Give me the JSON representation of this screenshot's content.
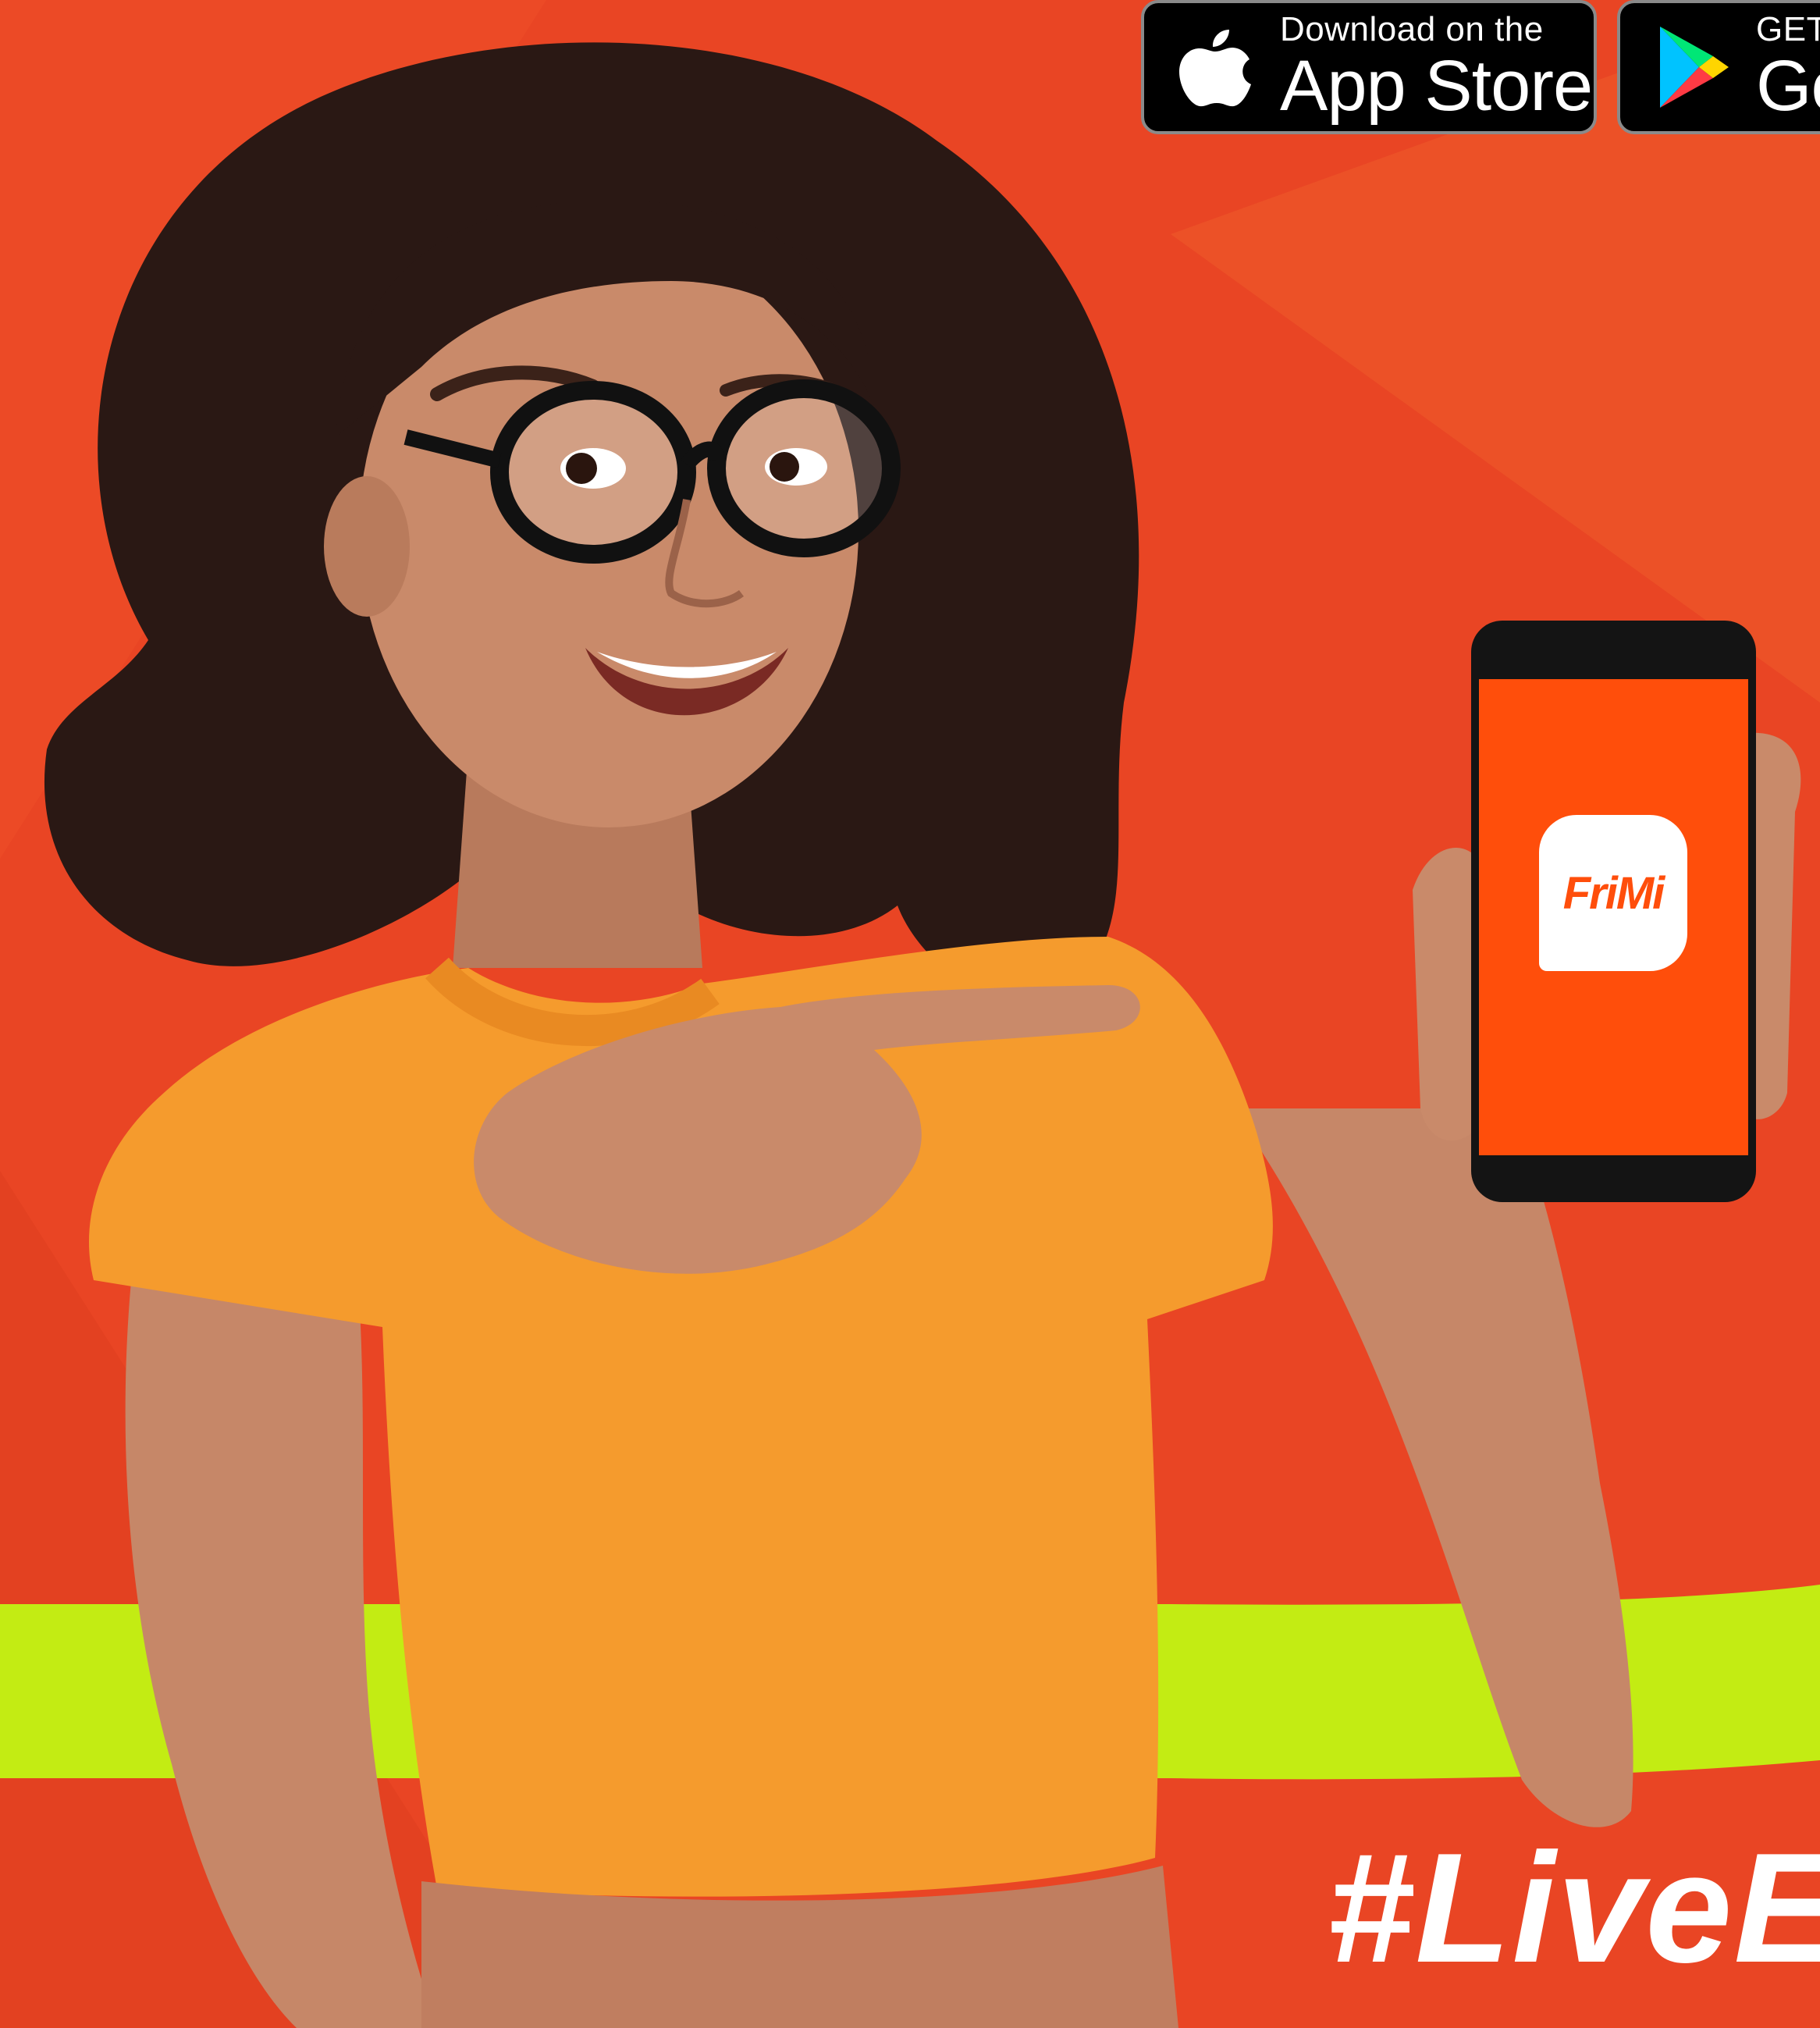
{
  "app_store_badge": {
    "small_text": "Download on the",
    "big_text": "App Store",
    "icon": "apple-icon"
  },
  "play_store_badge": {
    "small_text": "GET IT ON",
    "big_text": "Google Play",
    "icon": "google-play-icon"
  },
  "phone_app_logo": {
    "text": "FriMi"
  },
  "hashtag": "#LiveEffortlessly",
  "colors": {
    "background": "#e94524",
    "lime_band": "#c3ec13",
    "shirt": "#f59b2d",
    "phone_screen": "#ff4e0b",
    "hair": "#2a1814",
    "skin": "#c98a6a"
  }
}
